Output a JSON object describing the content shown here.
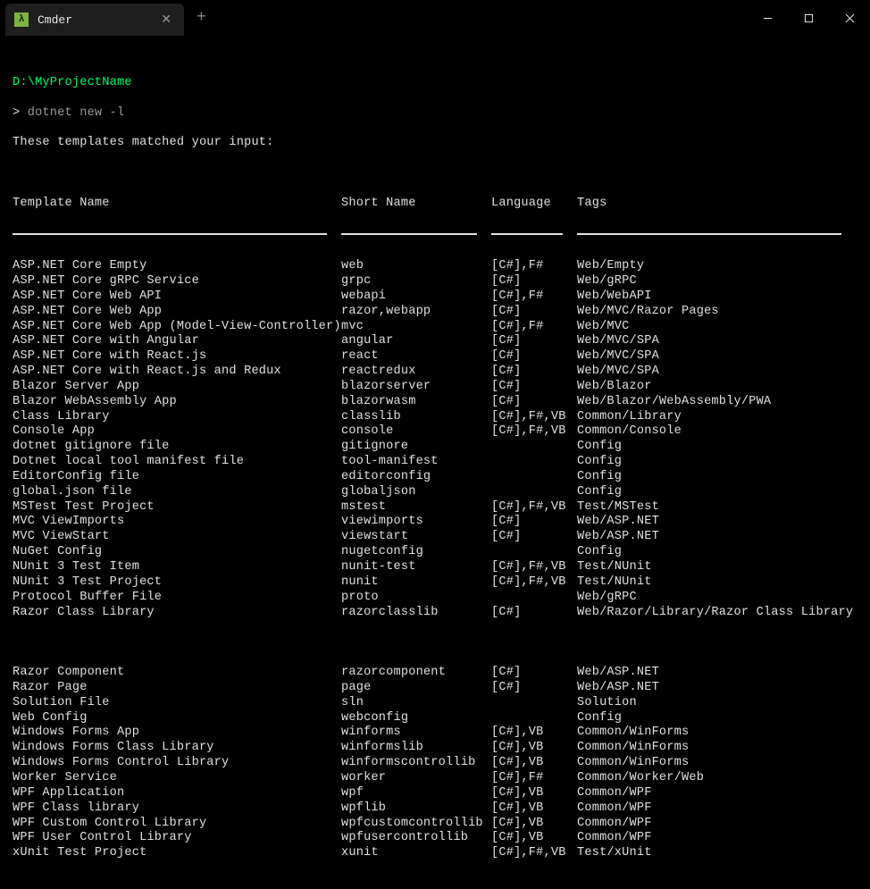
{
  "titlebar": {
    "tab_title": "Cmder",
    "tab_icon": "λ"
  },
  "prompt": {
    "path": "D:\\MyProjectName",
    "symbol": ">",
    "command": "dotnet new -l"
  },
  "intro": "These templates matched your input:",
  "headers": {
    "template": "Template Name",
    "shortname": "Short Name",
    "language": "Language",
    "tags": "Tags"
  },
  "rules": {
    "c1": 352,
    "c2": 152,
    "c3": 80,
    "c4": 296
  },
  "rows": [
    {
      "template": "ASP.NET Core Empty",
      "shortname": "web",
      "language": "[C#],F#",
      "tags": "Web/Empty"
    },
    {
      "template": "ASP.NET Core gRPC Service",
      "shortname": "grpc",
      "language": "[C#]",
      "tags": "Web/gRPC"
    },
    {
      "template": "ASP.NET Core Web API",
      "shortname": "webapi",
      "language": "[C#],F#",
      "tags": "Web/WebAPI"
    },
    {
      "template": "ASP.NET Core Web App",
      "shortname": "razor,webapp",
      "language": "[C#]",
      "tags": "Web/MVC/Razor Pages"
    },
    {
      "template": "ASP.NET Core Web App (Model-View-Controller)",
      "shortname": "mvc",
      "language": "[C#],F#",
      "tags": "Web/MVC"
    },
    {
      "template": "ASP.NET Core with Angular",
      "shortname": "angular",
      "language": "[C#]",
      "tags": "Web/MVC/SPA"
    },
    {
      "template": "ASP.NET Core with React.js",
      "shortname": "react",
      "language": "[C#]",
      "tags": "Web/MVC/SPA"
    },
    {
      "template": "ASP.NET Core with React.js and Redux",
      "shortname": "reactredux",
      "language": "[C#]",
      "tags": "Web/MVC/SPA"
    },
    {
      "template": "Blazor Server App",
      "shortname": "blazorserver",
      "language": "[C#]",
      "tags": "Web/Blazor"
    },
    {
      "template": "Blazor WebAssembly App",
      "shortname": "blazorwasm",
      "language": "[C#]",
      "tags": "Web/Blazor/WebAssembly/PWA"
    },
    {
      "template": "Class Library",
      "shortname": "classlib",
      "language": "[C#],F#,VB",
      "tags": "Common/Library"
    },
    {
      "template": "Console App",
      "shortname": "console",
      "language": "[C#],F#,VB",
      "tags": "Common/Console"
    },
    {
      "template": "dotnet gitignore file",
      "shortname": "gitignore",
      "language": "",
      "tags": "Config"
    },
    {
      "template": "Dotnet local tool manifest file",
      "shortname": "tool-manifest",
      "language": "",
      "tags": "Config"
    },
    {
      "template": "EditorConfig file",
      "shortname": "editorconfig",
      "language": "",
      "tags": "Config"
    },
    {
      "template": "global.json file",
      "shortname": "globaljson",
      "language": "",
      "tags": "Config"
    },
    {
      "template": "MSTest Test Project",
      "shortname": "mstest",
      "language": "[C#],F#,VB",
      "tags": "Test/MSTest"
    },
    {
      "template": "MVC ViewImports",
      "shortname": "viewimports",
      "language": "[C#]",
      "tags": "Web/ASP.NET"
    },
    {
      "template": "MVC ViewStart",
      "shortname": "viewstart",
      "language": "[C#]",
      "tags": "Web/ASP.NET"
    },
    {
      "template": "NuGet Config",
      "shortname": "nugetconfig",
      "language": "",
      "tags": "Config"
    },
    {
      "template": "NUnit 3 Test Item",
      "shortname": "nunit-test",
      "language": "[C#],F#,VB",
      "tags": "Test/NUnit"
    },
    {
      "template": "NUnit 3 Test Project",
      "shortname": "nunit",
      "language": "[C#],F#,VB",
      "tags": "Test/NUnit"
    },
    {
      "template": "Protocol Buffer File",
      "shortname": "proto",
      "language": "",
      "tags": "Web/gRPC"
    },
    {
      "template": "Razor Class Library",
      "shortname": "razorclasslib",
      "language": "[C#]",
      "tags": "Web/Razor/Library/Razor Class Library"
    }
  ],
  "rows2": [
    {
      "template": "Razor Component",
      "shortname": "razorcomponent",
      "language": "[C#]",
      "tags": "Web/ASP.NET"
    },
    {
      "template": "Razor Page",
      "shortname": "page",
      "language": "[C#]",
      "tags": "Web/ASP.NET"
    },
    {
      "template": "Solution File",
      "shortname": "sln",
      "language": "",
      "tags": "Solution"
    },
    {
      "template": "Web Config",
      "shortname": "webconfig",
      "language": "",
      "tags": "Config"
    },
    {
      "template": "Windows Forms App",
      "shortname": "winforms",
      "language": "[C#],VB",
      "tags": "Common/WinForms"
    },
    {
      "template": "Windows Forms Class Library",
      "shortname": "winformslib",
      "language": "[C#],VB",
      "tags": "Common/WinForms"
    },
    {
      "template": "Windows Forms Control Library",
      "shortname": "winformscontrollib",
      "language": "[C#],VB",
      "tags": "Common/WinForms"
    },
    {
      "template": "Worker Service",
      "shortname": "worker",
      "language": "[C#],F#",
      "tags": "Common/Worker/Web"
    },
    {
      "template": "WPF Application",
      "shortname": "wpf",
      "language": "[C#],VB",
      "tags": "Common/WPF"
    },
    {
      "template": "WPF Class library",
      "shortname": "wpflib",
      "language": "[C#],VB",
      "tags": "Common/WPF"
    },
    {
      "template": "WPF Custom Control Library",
      "shortname": "wpfcustomcontrollib",
      "language": "[C#],VB",
      "tags": "Common/WPF"
    },
    {
      "template": "WPF User Control Library",
      "shortname": "wpfusercontrollib",
      "language": "[C#],VB",
      "tags": "Common/WPF"
    },
    {
      "template": "xUnit Test Project",
      "shortname": "xunit",
      "language": "[C#],F#,VB",
      "tags": "Test/xUnit"
    }
  ]
}
